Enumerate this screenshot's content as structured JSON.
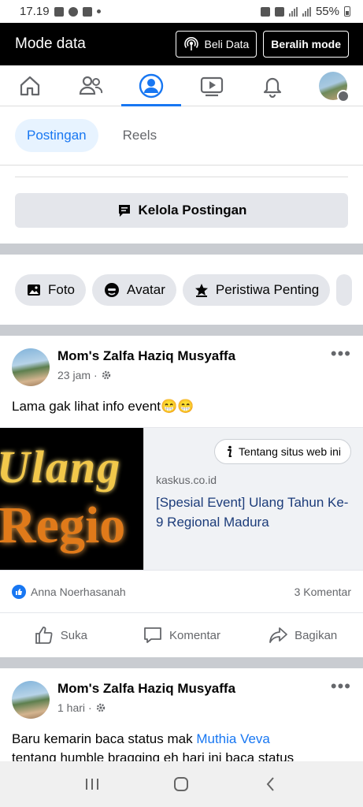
{
  "status_bar": {
    "time": "17.19",
    "battery": "55%"
  },
  "mode_bar": {
    "title": "Mode data",
    "buy_data_label": "Beli Data",
    "switch_mode_label": "Beralih mode"
  },
  "nav": {
    "items": [
      {
        "icon": "home-icon"
      },
      {
        "icon": "friends-icon"
      },
      {
        "icon": "profile-icon",
        "active": true
      },
      {
        "icon": "watch-icon"
      },
      {
        "icon": "bell-icon"
      },
      {
        "icon": "menu-avatar"
      }
    ]
  },
  "tabs": {
    "posts": "Postingan",
    "reels": "Reels"
  },
  "manage": {
    "label": "Kelola Postingan"
  },
  "chips": {
    "photo": "Foto",
    "avatar": "Avatar",
    "life_event": "Peristiwa Penting"
  },
  "posts": [
    {
      "author": "Mom's Zalfa Haziq Musyaffa",
      "time": "23 jam",
      "text": "Lama gak lihat info event😁😁",
      "link": {
        "thumb_line1": "Ulang",
        "thumb_line2": "Regio",
        "about_label": "Tentang situs web ini",
        "domain": "kaskus.co.id",
        "title": "[Spesial Event] Ulang Tahun Ke-9 Regional Madura"
      },
      "reaction_name": "Anna Noerhasanah",
      "comment_count": "3 Komentar",
      "actions": {
        "like": "Suka",
        "comment": "Komentar",
        "share": "Bagikan"
      }
    },
    {
      "author": "Mom's Zalfa Haziq Musyaffa",
      "time": "1 hari",
      "text_before": "Baru kemarin baca status mak ",
      "mention": "Muthia Veva",
      "text_after": "tentang humble bragging eh hari ini baca status"
    }
  ],
  "colors": {
    "accent": "#1877f2",
    "separator": "#c9ccd1"
  }
}
